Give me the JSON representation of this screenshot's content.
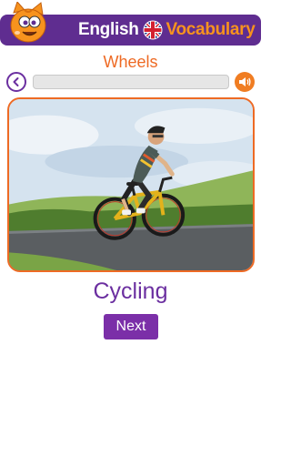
{
  "header": {
    "title_part1": "English",
    "title_part2": "Vocabulary",
    "mascot_icon": "cat-mascot-icon",
    "flag_icon": "uk-flag-icon"
  },
  "category": {
    "title": "Wheels"
  },
  "controls": {
    "back_icon": "chevron-left-icon",
    "sound_icon": "speaker-icon",
    "progress": 0
  },
  "card": {
    "image": "cyclist-photo",
    "word": "Cycling"
  },
  "actions": {
    "next_label": "Next"
  },
  "colors": {
    "header_bg": "#5f2d90",
    "accent_orange": "#ee6a24",
    "accent_purple": "#6b2fa0",
    "button_purple": "#7b2fa8"
  }
}
